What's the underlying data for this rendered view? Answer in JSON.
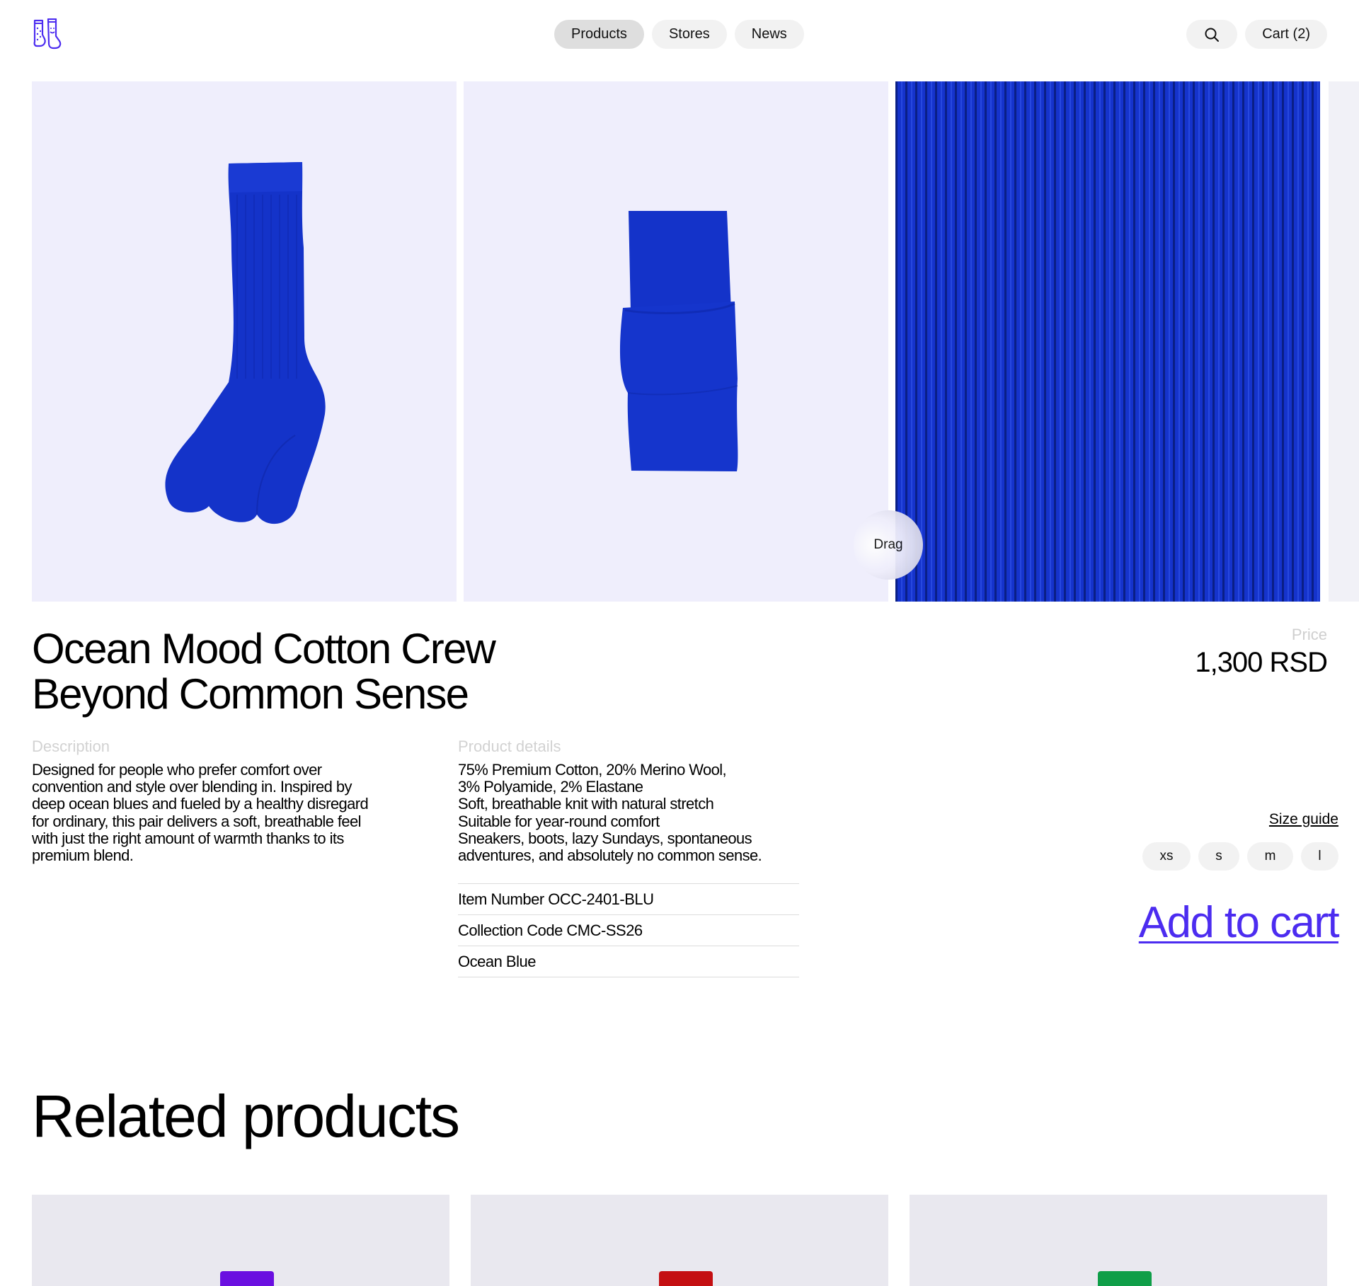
{
  "header": {
    "logo_name": "socks-logo",
    "nav": [
      {
        "label": "Products",
        "active": true
      },
      {
        "label": "Stores",
        "active": false
      },
      {
        "label": "News",
        "active": false
      }
    ],
    "search_icon": "search-icon",
    "cart_label": "Cart (2)"
  },
  "gallery": {
    "drag_label": "Drag",
    "sock_color": "#1130c4",
    "slide_background": "#efeefc"
  },
  "product": {
    "title_line1": "Ocean Mood Cotton Crew",
    "title_line2": "Beyond Common Sense",
    "price_label": "Price",
    "price": "1,300 RSD",
    "description_label": "Description",
    "description": "Designed for people who prefer comfort over convention and style over blending in. Inspired by deep ocean blues and fueled by a healthy disregard for ordinary, this pair delivers a soft, breathable feel with just the right amount of warmth thanks to its premium blend.",
    "details_label": "Product details",
    "details_lines": [
      "75% Premium Cotton, 20% Merino Wool,",
      "3% Polyamide, 2% Elastane",
      "Soft, breathable knit with natural stretch",
      "Suitable for year-round comfort",
      "Sneakers, boots, lazy Sundays, spontaneous",
      "adventures, and absolutely no common sense."
    ],
    "specs": [
      "Item Number OCC-2401-BLU",
      "Collection Code CMC-SS26",
      "Ocean Blue"
    ],
    "size_guide_label": "Size guide",
    "sizes": [
      "xs",
      "s",
      "m",
      "l"
    ],
    "add_to_cart_label": "Add to cart",
    "accent_color": "#4c2cf0"
  },
  "related": {
    "title": "Related products",
    "items": [
      {
        "sock_color": "#6a0fe0"
      },
      {
        "sock_color": "#c40f12"
      },
      {
        "sock_color": "#0f9e48"
      }
    ]
  }
}
